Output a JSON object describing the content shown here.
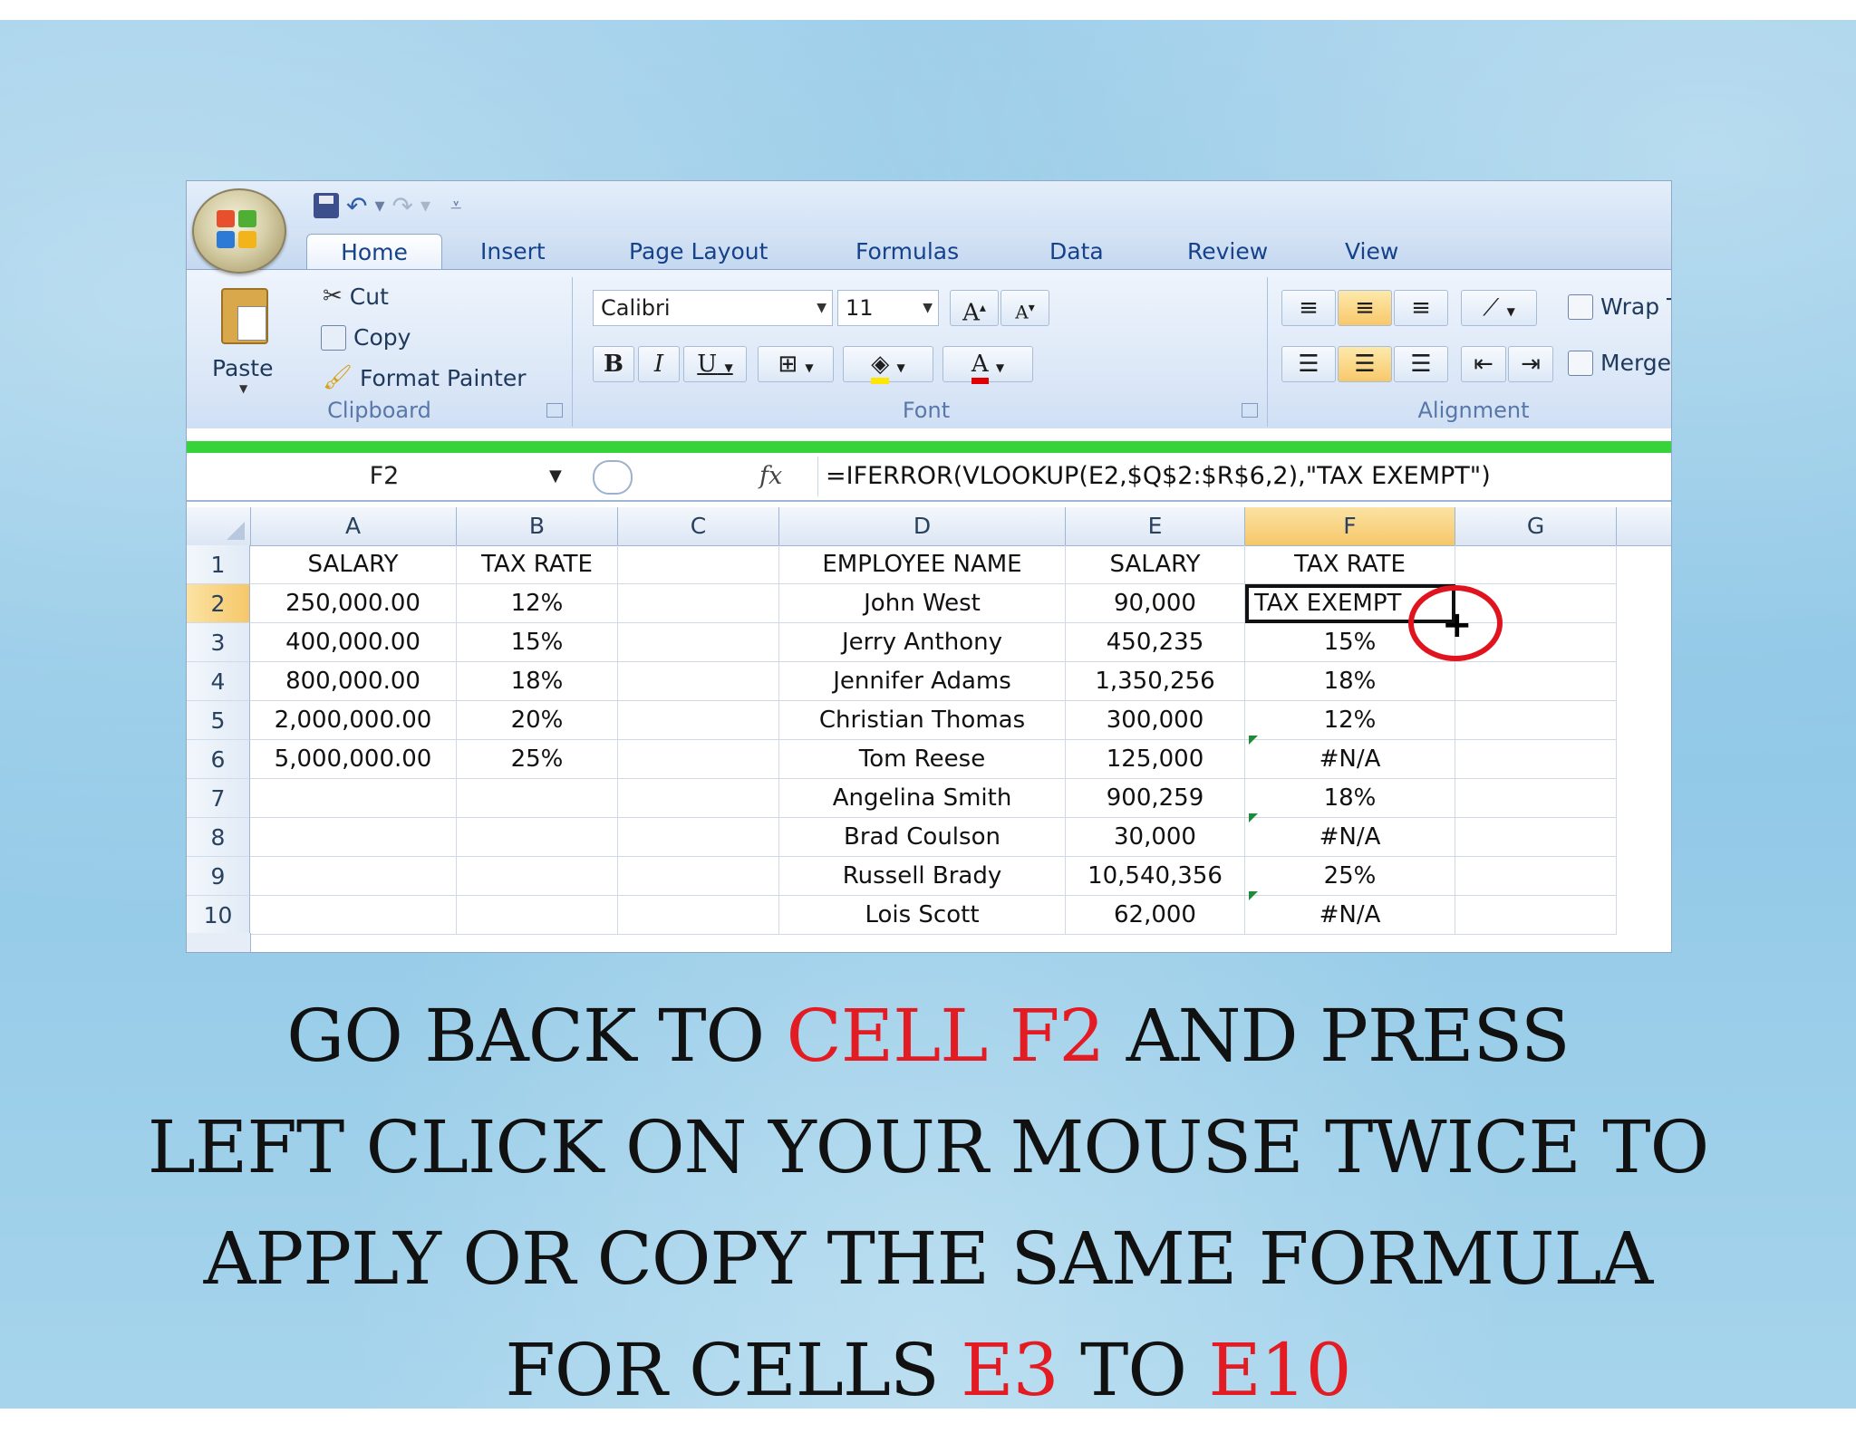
{
  "window": {
    "tabs": [
      "Home",
      "Insert",
      "Page Layout",
      "Formulas",
      "Data",
      "Review",
      "View"
    ],
    "active_tab": "Home"
  },
  "ribbon": {
    "clipboard": {
      "paste": "Paste",
      "cut": "Cut",
      "copy": "Copy",
      "format_painter": "Format Painter",
      "label": "Clipboard"
    },
    "font": {
      "font_name": "Calibri",
      "font_size": "11",
      "bold": "B",
      "italic": "I",
      "underline": "U",
      "grow": "A",
      "shrink": "A",
      "font_color": "A",
      "label": "Font"
    },
    "alignment": {
      "wrap_text": "Wrap Text",
      "merge_center": "Merge & Center",
      "label": "Alignment"
    }
  },
  "formula_bar": {
    "name_box": "F2",
    "fx": "fx",
    "formula": "=IFERROR(VLOOKUP(E2,$Q$2:$R$6,2),\"TAX EXEMPT\")"
  },
  "sheet": {
    "columns": [
      "A",
      "B",
      "C",
      "D",
      "E",
      "F",
      "G"
    ],
    "selected_column": "F",
    "selected_row": "2",
    "rows": [
      {
        "num": "1",
        "A": "SALARY",
        "B": "TAX RATE",
        "C": "",
        "D": "EMPLOYEE NAME",
        "E": "SALARY",
        "F": "TAX RATE",
        "G": ""
      },
      {
        "num": "2",
        "A": "250,000.00",
        "B": "12%",
        "C": "",
        "D": "John West",
        "E": "90,000",
        "F": "TAX EXEMPT",
        "G": ""
      },
      {
        "num": "3",
        "A": "400,000.00",
        "B": "15%",
        "C": "",
        "D": "Jerry Anthony",
        "E": "450,235",
        "F": "15%",
        "G": ""
      },
      {
        "num": "4",
        "A": "800,000.00",
        "B": "18%",
        "C": "",
        "D": "Jennifer Adams",
        "E": "1,350,256",
        "F": "18%",
        "G": ""
      },
      {
        "num": "5",
        "A": "2,000,000.00",
        "B": "20%",
        "C": "",
        "D": "Christian Thomas",
        "E": "300,000",
        "F": "12%",
        "G": ""
      },
      {
        "num": "6",
        "A": "5,000,000.00",
        "B": "25%",
        "C": "",
        "D": "Tom Reese",
        "E": "125,000",
        "F": "#N/A",
        "G": ""
      },
      {
        "num": "7",
        "A": "",
        "B": "",
        "C": "",
        "D": "Angelina Smith",
        "E": "900,259",
        "F": "18%",
        "G": ""
      },
      {
        "num": "8",
        "A": "",
        "B": "",
        "C": "",
        "D": "Brad Coulson",
        "E": "30,000",
        "F": "#N/A",
        "G": ""
      },
      {
        "num": "9",
        "A": "",
        "B": "",
        "C": "",
        "D": "Russell Brady",
        "E": "10,540,356",
        "F": "25%",
        "G": ""
      },
      {
        "num": "10",
        "A": "",
        "B": "",
        "C": "",
        "D": "Lois Scott",
        "E": "62,000",
        "F": "#N/A",
        "G": ""
      }
    ]
  },
  "caption": {
    "line1_a": "GO BACK TO ",
    "line1_red": "CELL F2",
    "line1_b": " AND PRESS",
    "line2": "LEFT CLICK ON YOUR MOUSE TWICE TO",
    "line3": "APPLY OR COPY THE SAME FORMULA",
    "line4_a": "FOR CELLS ",
    "line4_red1": "E3",
    "line4_b": " TO ",
    "line4_red2": "E10"
  },
  "colors": {
    "highlight_red": "#e31b23",
    "green_bar": "#36d43a",
    "cursor_ring": "#e0141e",
    "background_blue": "#9ccde9"
  }
}
